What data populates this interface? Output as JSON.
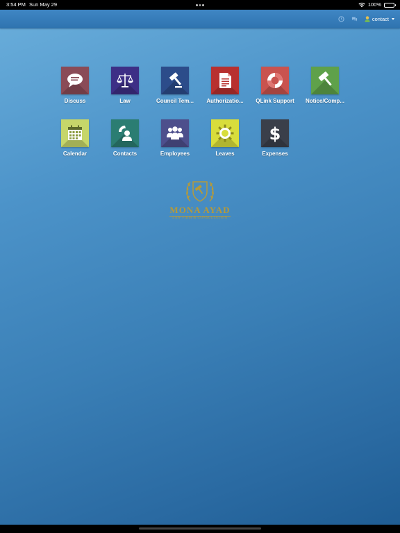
{
  "status_bar": {
    "time": "3:54 PM",
    "date": "Sun May 29",
    "battery": "100%"
  },
  "nav": {
    "user_label": "contact"
  },
  "apps": [
    {
      "label": "Discuss",
      "icon": "chat-bubble-icon",
      "color": "#8a4b57"
    },
    {
      "label": "Law",
      "icon": "scales-icon",
      "color": "#3d2f86"
    },
    {
      "label": "Council Tem...",
      "icon": "gavel-icon",
      "color": "#2c4c8a"
    },
    {
      "label": "Authorizatio...",
      "icon": "document-icon",
      "color": "#b8302f"
    },
    {
      "label": "QLink Support",
      "icon": "life-ring-icon",
      "color": "#c9534f"
    },
    {
      "label": "Notice/Comp...",
      "icon": "gavel-icon",
      "color": "#5fa14a"
    },
    {
      "label": "Calendar",
      "icon": "calendar-icon",
      "color": "#c6d66a"
    },
    {
      "label": "Contacts",
      "icon": "contact-phone-icon",
      "color": "#2b7d72"
    },
    {
      "label": "Employees",
      "icon": "group-icon",
      "color": "#4d4f8c"
    },
    {
      "label": "Leaves",
      "icon": "sun-icon",
      "color": "#d8dd3c"
    },
    {
      "label": "Expenses",
      "icon": "dollar-icon",
      "color": "#3a3f4a"
    }
  ],
  "logo": {
    "name": "MONA AYAD",
    "tagline": "LAW FIRM & CONSULTATION",
    "color": "#b59a3a"
  }
}
